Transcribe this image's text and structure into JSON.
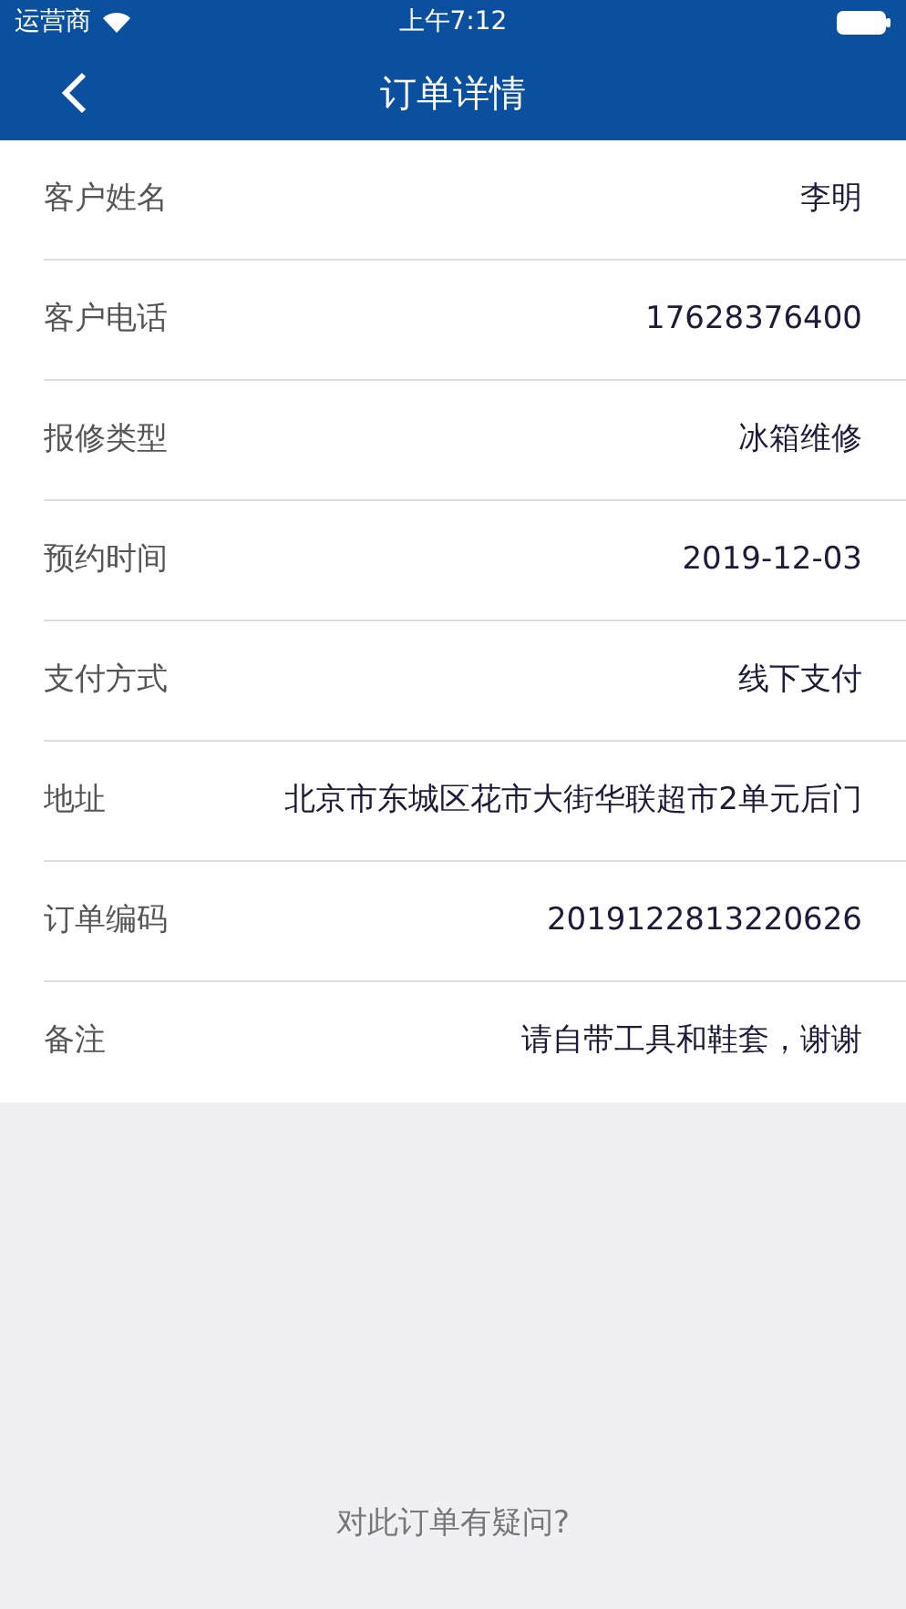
{
  "status_bar": {
    "carrier": "运营商",
    "time": "上午7:12"
  },
  "nav": {
    "title": "订单详情"
  },
  "rows": [
    {
      "label": "客户姓名",
      "value": "李明"
    },
    {
      "label": "客户电话",
      "value": "17628376400"
    },
    {
      "label": "报修类型",
      "value": "冰箱维修"
    },
    {
      "label": "预约时间",
      "value": "2019-12-03"
    },
    {
      "label": "支付方式",
      "value": "线下支付"
    },
    {
      "label": "地址",
      "value": "北京市东城区花市大街华联超市2单元后门"
    },
    {
      "label": "订单编码",
      "value": "2019122813220626"
    },
    {
      "label": "备注",
      "value": "请自带工具和鞋套，谢谢"
    }
  ],
  "footer_link": "对此订单有疑问?"
}
